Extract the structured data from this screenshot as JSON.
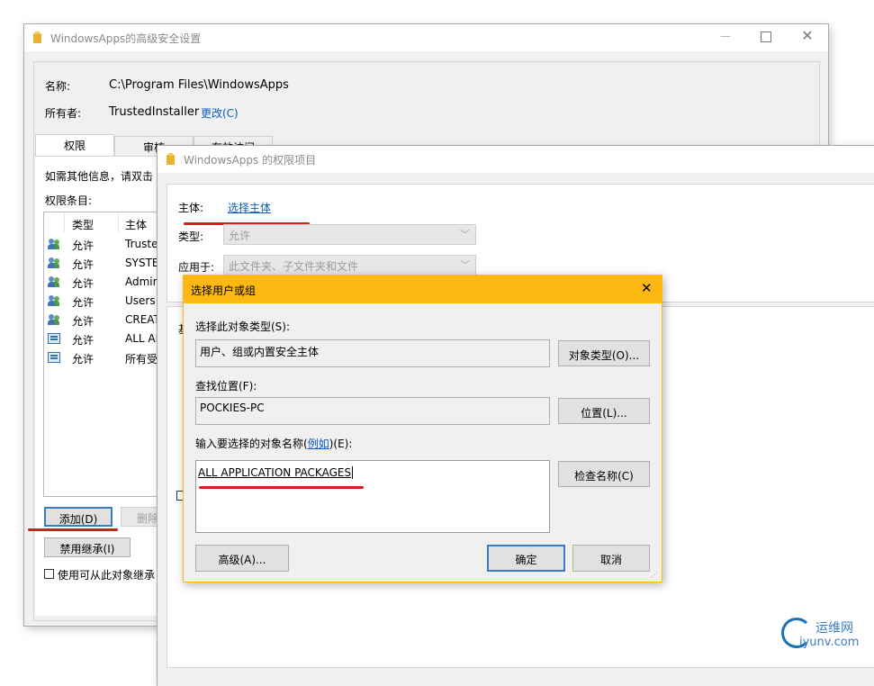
{
  "win1": {
    "title": "WindowsApps的高级安全设置",
    "name_label": "名称:",
    "name_value": "C:\\Program Files\\WindowsApps",
    "owner_label": "所有者:",
    "owner_value": "TrustedInstaller",
    "change_link": "更改(C)",
    "tabs": [
      "权限",
      "审核",
      "有效访问"
    ],
    "info_text": "如需其他信息，请双击",
    "entries_label": "权限条目:",
    "columns": [
      "类型",
      "主体"
    ],
    "rows": [
      {
        "icon": "user-group-icon",
        "type": "允许",
        "principal": "Truste"
      },
      {
        "icon": "user-group-icon",
        "type": "允许",
        "principal": "SYSTE"
      },
      {
        "icon": "user-group-icon",
        "type": "允许",
        "principal": "Admin"
      },
      {
        "icon": "user-group-icon",
        "type": "允许",
        "principal": "Users"
      },
      {
        "icon": "user-group-icon",
        "type": "允许",
        "principal": "CREAT"
      },
      {
        "icon": "app-package-icon",
        "type": "允许",
        "principal": "ALL AP"
      },
      {
        "icon": "app-package-icon",
        "type": "允许",
        "principal": "所有受"
      }
    ],
    "add_button": "添加(D)",
    "remove_button": "删除",
    "disable_inherit_button": "禁用继承(I)",
    "replace_checkbox_label": "使用可从此对象继承"
  },
  "win2": {
    "title": "WindowsApps 的权限项目",
    "principal_label": "主体:",
    "principal_link": "选择主体",
    "type_label": "类型:",
    "type_value": "允许",
    "applies_label": "应用于:",
    "applies_value": "此文件夹、子文件夹和文件",
    "basic_label_fragment": "基"
  },
  "dialog": {
    "title": "选择用户或组",
    "object_type_label": "选择此对象类型(S):",
    "object_type_value": "用户、组或内置安全主体",
    "object_types_button": "对象类型(O)...",
    "location_label": "查找位置(F):",
    "location_value": "POCKIES-PC",
    "locations_button": "位置(L)...",
    "enter_names_label_pre": "输入要选择的对象名称(",
    "enter_names_link": "例如",
    "enter_names_label_post": ")(E):",
    "names_value": "ALL APPLICATION PACKAGES",
    "check_names_button": "检查名称(C)",
    "advanced_button": "高级(A)...",
    "ok_button": "确定",
    "cancel_button": "取消"
  },
  "watermark": {
    "line1": "运维网",
    "line2": "iyunv.com"
  },
  "colors": {
    "dialog_title_bar": "#fdb812",
    "annotation_red": "#d61c1c",
    "link_blue": "#0a5fbf"
  }
}
